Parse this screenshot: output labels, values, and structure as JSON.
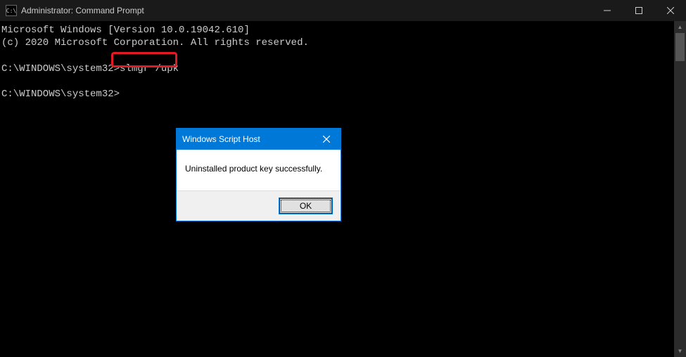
{
  "window": {
    "title": "Administrator: Command Prompt",
    "icon_label": "C:\\"
  },
  "terminal": {
    "line1": "Microsoft Windows [Version 10.0.19042.610]",
    "line2": "(c) 2020 Microsoft Corporation. All rights reserved.",
    "blank1": "",
    "prompt1_prefix": "C:\\WINDOWS\\system32>",
    "prompt1_cmd": "slmgr /upk",
    "blank2": "",
    "prompt2_prefix": "C:\\WINDOWS\\system32>",
    "prompt2_cmd": ""
  },
  "dialog": {
    "title": "Windows Script Host",
    "message": "Uninstalled product key successfully.",
    "ok_label": "OK"
  }
}
